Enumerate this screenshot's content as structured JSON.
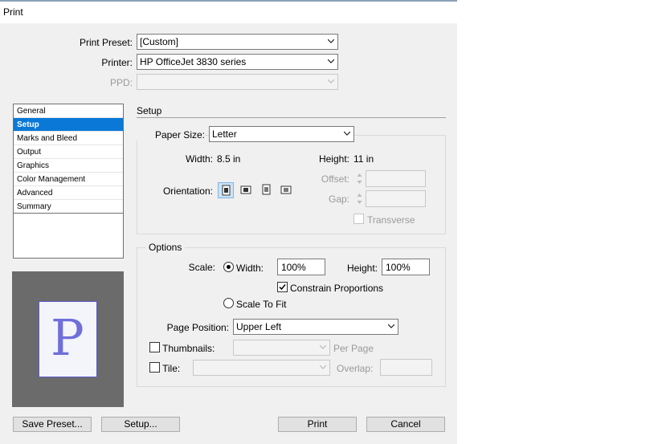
{
  "window": {
    "title": "Print"
  },
  "top": {
    "preset_label": "Print Preset:",
    "preset_value": "[Custom]",
    "printer_label": "Printer:",
    "printer_value": "HP OfficeJet 3830 series",
    "ppd_label": "PPD:",
    "ppd_value": ""
  },
  "sidebar": {
    "items": [
      {
        "label": "General"
      },
      {
        "label": "Setup",
        "selected": true
      },
      {
        "label": "Marks and Bleed"
      },
      {
        "label": "Output"
      },
      {
        "label": "Graphics"
      },
      {
        "label": "Color Management"
      },
      {
        "label": "Advanced"
      },
      {
        "label": "Summary"
      }
    ]
  },
  "preview": {
    "letter": "P"
  },
  "setup": {
    "heading": "Setup",
    "paper_size_label": "Paper Size:",
    "paper_size_value": "Letter",
    "width_label": "Width:",
    "width_value": "8.5 in",
    "height_label": "Height:",
    "height_value": "11 in",
    "offset_label": "Offset:",
    "gap_label": "Gap:",
    "orientation_label": "Orientation:",
    "orientation_icons": [
      "portrait-icon",
      "landscape-icon",
      "reverse-portrait-icon",
      "reverse-landscape-icon"
    ],
    "transverse_label": "Transverse"
  },
  "options": {
    "heading": "Options",
    "scale_label": "Scale:",
    "width_label": "Width:",
    "width_value": "100%",
    "height_label": "Height:",
    "height_value": "100%",
    "constrain_label": "Constrain Proportions",
    "constrain_checked": true,
    "scale_to_fit_label": "Scale To Fit",
    "page_position_label": "Page Position:",
    "page_position_value": "Upper Left",
    "thumbnails_label": "Thumbnails:",
    "per_page_label": "Per Page",
    "tile_label": "Tile:",
    "overlap_label": "Overlap:"
  },
  "buttons": {
    "save_preset": "Save Preset...",
    "setup": "Setup...",
    "print": "Print",
    "cancel": "Cancel"
  },
  "colors": {
    "selection": "#0a78d7",
    "preview_bg": "#6b6b6b",
    "preview_letter": "#6f6fd9"
  }
}
